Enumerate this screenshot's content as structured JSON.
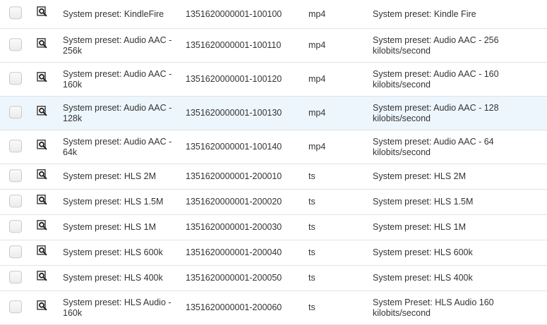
{
  "rows": [
    {
      "name": "System preset: KindleFire",
      "id": "1351620000001-100100",
      "container": "mp4",
      "description": "System preset: Kindle Fire"
    },
    {
      "name": "System preset: Audio AAC - 256k",
      "id": "1351620000001-100110",
      "container": "mp4",
      "description": "System preset: Audio AAC - 256 kilobits/second"
    },
    {
      "name": "System preset: Audio AAC - 160k",
      "id": "1351620000001-100120",
      "container": "mp4",
      "description": "System preset: Audio AAC - 160 kilobits/second"
    },
    {
      "name": "System preset: Audio AAC - 128k",
      "id": "1351620000001-100130",
      "container": "mp4",
      "description": "System preset: Audio AAC - 128 kilobits/second"
    },
    {
      "name": "System preset: Audio AAC - 64k",
      "id": "1351620000001-100140",
      "container": "mp4",
      "description": "System preset: Audio AAC - 64 kilobits/second"
    },
    {
      "name": "System preset: HLS 2M",
      "id": "1351620000001-200010",
      "container": "ts",
      "description": "System preset: HLS 2M"
    },
    {
      "name": "System preset: HLS 1.5M",
      "id": "1351620000001-200020",
      "container": "ts",
      "description": "System preset: HLS 1.5M"
    },
    {
      "name": "System preset: HLS 1M",
      "id": "1351620000001-200030",
      "container": "ts",
      "description": "System preset: HLS 1M"
    },
    {
      "name": "System preset: HLS 600k",
      "id": "1351620000001-200040",
      "container": "ts",
      "description": "System preset: HLS 600k"
    },
    {
      "name": "System preset: HLS 400k",
      "id": "1351620000001-200050",
      "container": "ts",
      "description": "System preset: HLS 400k"
    },
    {
      "name": "System preset: HLS Audio - 160k",
      "id": "1351620000001-200060",
      "container": "ts",
      "description": "System Preset: HLS Audio 160 kilobits/second"
    }
  ],
  "highlight_color": "#eef6fd"
}
